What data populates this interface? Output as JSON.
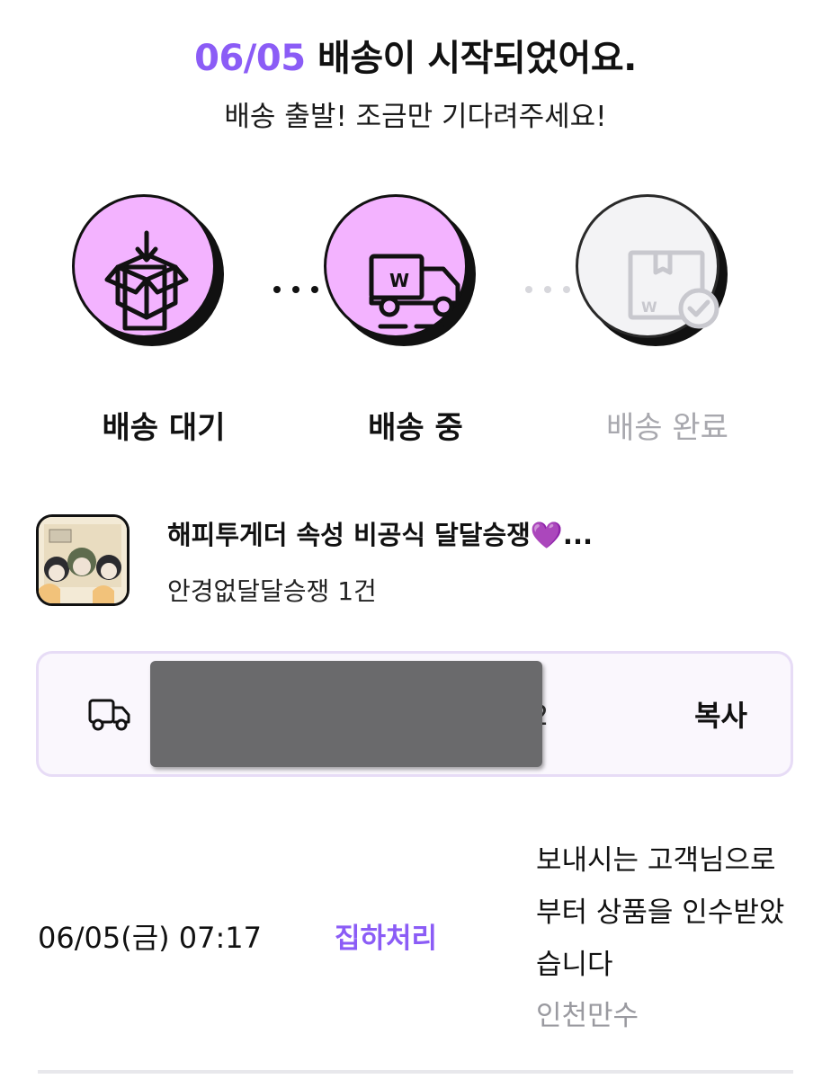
{
  "header": {
    "date": "06/05",
    "title_rest": "배송이 시작되었어요.",
    "subtitle": "배송 출발! 조금만 기다려주세요!"
  },
  "steps": [
    {
      "label": "배송 대기",
      "state": "done",
      "icon": "box-download-icon"
    },
    {
      "label": "배송 중",
      "state": "current",
      "icon": "delivery-truck-icon"
    },
    {
      "label": "배송 완료",
      "state": "pending",
      "icon": "package-check-icon"
    }
  ],
  "colors": {
    "accent": "#8b5cf6",
    "step_active_fill": "#f3b3ff",
    "step_inactive_fill": "#f3f3f5",
    "pending_text": "#a8a8ae"
  },
  "product": {
    "title": "해피투게더 속성 비공식 달달승쟁",
    "title_emoji": "💜",
    "ellipsis": "...",
    "subtitle": "안경없달달승쟁 1건"
  },
  "tracking": {
    "icon": "truck-outline-icon",
    "number_visible_fragment": "2",
    "masked": true,
    "copy_label": "복사"
  },
  "events": [
    {
      "time": "06/05(금) 07:17",
      "status": "집하처리",
      "description": "보내시는 고객님으로부터 상품을 인수받았습니다",
      "location": "인천만수"
    }
  ]
}
